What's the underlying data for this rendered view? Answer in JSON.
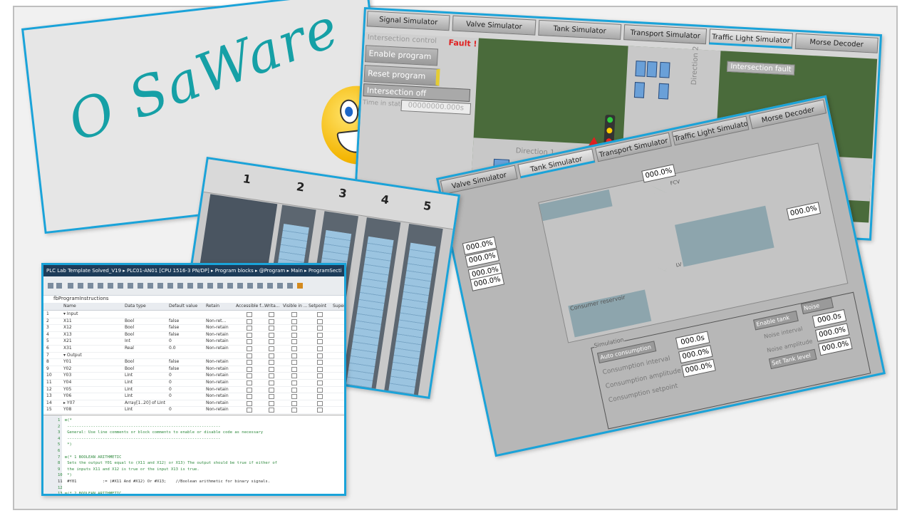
{
  "logo": {
    "text": "O SaWare"
  },
  "traffic": {
    "tabs": [
      "Signal Simulator",
      "Valve Simulator",
      "Tank Simulator",
      "Transport Simulator",
      "Traffic Light Simulator",
      "Morse Decoder"
    ],
    "section": "Intersection control",
    "fault": "Fault !",
    "enable_btn": "Enable program",
    "reset_btn": "Reset program",
    "status": "Intersection off",
    "time_label": "Time in state",
    "time_value": "00000000.000s",
    "fault_box": "Intersection fault",
    "direction1": "Direction 1",
    "direction2": "Direction 2"
  },
  "tank": {
    "tabs": [
      "Valve Simulator",
      "Tank Simulator",
      "Transport Simulator",
      "Traffic Light Simulator",
      "Morse Decoder"
    ],
    "top_value": "000.0%",
    "fcv": "FCV",
    "lv": "LV",
    "consumer": "Consumer reservoir",
    "left_values": [
      "000.0%",
      "000.0%",
      "000.0%",
      "000.0%"
    ],
    "simulation": "Simulation",
    "auto_consumption": "Auto consumption",
    "consumption_interval": "Consumption interval",
    "consumption_interval_val": "000.0s",
    "consumption_amplitude": "Consumption amplitude",
    "consumption_amplitude_val": "000.0%",
    "consumption_setpoint": "Consumption setpoint",
    "consumption_setpoint_val": "000.0%",
    "enable_tank": "Enable tank",
    "noise": "Noise",
    "noise_interval": "Noise interval",
    "noise_interval_val": "000.0s",
    "noise_amplitude": "Noise amplitude",
    "noise_amplitude_val": "000.0%",
    "set_tank_level": "Set Tank level",
    "set_tank_val": "000.0%",
    "right_value": "000.0%"
  },
  "rack": {
    "slots": [
      "1",
      "2",
      "3",
      "4",
      "5"
    ]
  },
  "tia": {
    "title": "PLC Lab Template Solved_V19 ▸ PLC01-AN01 [CPU 1516-3 PN/DP] ▸ Program blocks ▸ @Program ▸ Main ▸ ProgramSecti",
    "block": "fbProgramInstructions",
    "headers": [
      "Name",
      "Data type",
      "Default value",
      "Retain",
      "Accessible f...",
      "Writa...",
      "Visible in ...",
      "Setpoint",
      "Super"
    ],
    "rows": [
      {
        "num": "1",
        "name": "▾ Input",
        "type": "",
        "def": "",
        "ret": ""
      },
      {
        "num": "2",
        "name": "X11",
        "type": "Bool",
        "def": "false",
        "ret": "Non-ret..."
      },
      {
        "num": "3",
        "name": "X12",
        "type": "Bool",
        "def": "false",
        "ret": "Non-retain"
      },
      {
        "num": "4",
        "name": "X13",
        "type": "Bool",
        "def": "false",
        "ret": "Non-retain"
      },
      {
        "num": "5",
        "name": "X21",
        "type": "Int",
        "def": "0",
        "ret": "Non-retain"
      },
      {
        "num": "6",
        "name": "X31",
        "type": "Real",
        "def": "0.0",
        "ret": "Non-retain"
      },
      {
        "num": "7",
        "name": "▾ Output",
        "type": "",
        "def": "",
        "ret": ""
      },
      {
        "num": "8",
        "name": "Y01",
        "type": "Bool",
        "def": "false",
        "ret": "Non-retain"
      },
      {
        "num": "9",
        "name": "Y02",
        "type": "Bool",
        "def": "false",
        "ret": "Non-retain"
      },
      {
        "num": "10",
        "name": "Y03",
        "type": "LInt",
        "def": "0",
        "ret": "Non-retain"
      },
      {
        "num": "11",
        "name": "Y04",
        "type": "LInt",
        "def": "0",
        "ret": "Non-retain"
      },
      {
        "num": "12",
        "name": "Y05",
        "type": "LInt",
        "def": "0",
        "ret": "Non-retain"
      },
      {
        "num": "13",
        "name": "Y06",
        "type": "LInt",
        "def": "0",
        "ret": "Non-retain"
      },
      {
        "num": "14",
        "name": "▸ Y07",
        "type": "Array[1..20] of LInt",
        "def": "",
        "ret": "Non-retain"
      },
      {
        "num": "15",
        "name": "Y08",
        "type": "LInt",
        "def": "0",
        "ret": "Non-retain"
      }
    ],
    "code": [
      "1  ⊟(*",
      "2   -----------------------------------------------------------------",
      "3   General: Use line comments or block comments to enable or disable code as necessary",
      "4   -----------------------------------------------------------------",
      "5   *)",
      "6",
      "7  ⊟(* 1 BOOLEAN ARITHMETIC",
      "8   Sets the output Y01 equal to (X11 and X12) or X13) The output should be true if either of",
      "9   the inputs X11 and X12 is true or the input X13 is true.",
      "10  *)",
      "11  #Y01           := (#X11 And #X12) Or #X13;    //Boolean arithmetic for binary signals.",
      "12",
      "13 ⊟(* 2 BOOLEAN ARITHMETIC"
    ]
  }
}
